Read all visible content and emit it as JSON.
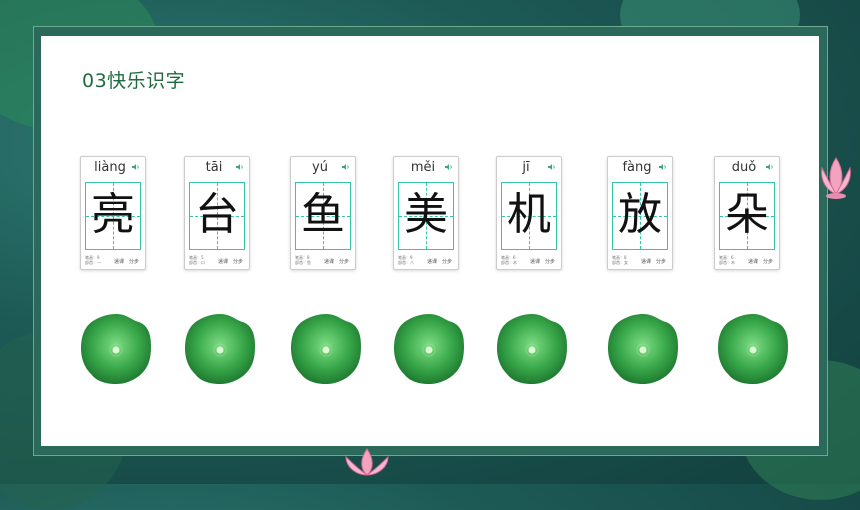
{
  "section_title": "03快乐识字",
  "colors": {
    "title": "#1f6b3f",
    "grid": "#36c6a4",
    "pad": "#2fa04a",
    "frame": "#2b6a5b"
  },
  "cards": [
    {
      "pinyin": "liàng",
      "char": "亮",
      "meta": "笔画：9\n部首：一",
      "btn_classroom": "递课",
      "btn_step": "分步"
    },
    {
      "pinyin": "tāi",
      "char": "台",
      "meta": "笔画：5\n部首：口",
      "btn_classroom": "递课",
      "btn_step": "分步"
    },
    {
      "pinyin": "yú",
      "char": "鱼",
      "meta": "笔画：8\n部首：鱼",
      "btn_classroom": "递课",
      "btn_step": "分步"
    },
    {
      "pinyin": "měi",
      "char": "美",
      "meta": "笔画：9\n部首：八",
      "btn_classroom": "递课",
      "btn_step": "分步"
    },
    {
      "pinyin": "jī",
      "char": "机",
      "meta": "笔画：6\n部首：木",
      "btn_classroom": "递课",
      "btn_step": "分步"
    },
    {
      "pinyin": "fàng",
      "char": "放",
      "meta": "笔画：8\n部首：女",
      "btn_classroom": "递课",
      "btn_step": "分步"
    },
    {
      "pinyin": "duǒ",
      "char": "朵",
      "meta": "笔画：6\n部首：木",
      "btn_classroom": "递课",
      "btn_step": "分步"
    }
  ],
  "icons": {
    "speaker": "speaker-icon",
    "pad": "lily-pad-icon",
    "flower": "lotus-flower-icon"
  }
}
